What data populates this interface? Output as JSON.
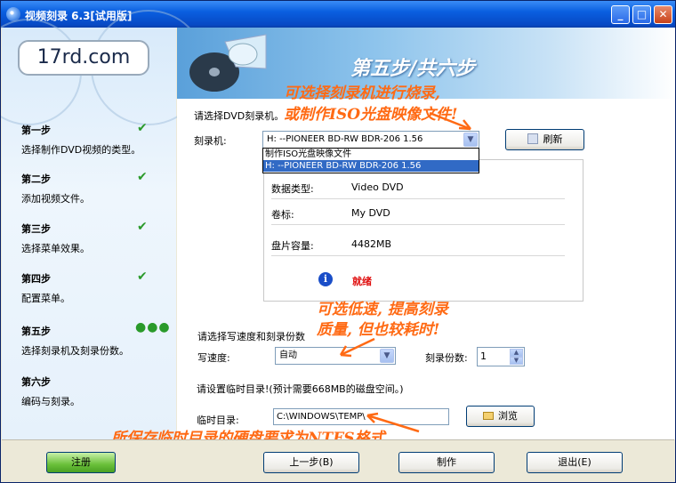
{
  "window": {
    "title": "视频刻录  6.3[试用版]",
    "minimize_glyph": "_",
    "maximize_glyph": "□",
    "close_glyph": "✕"
  },
  "logo": {
    "text": "17rd.com"
  },
  "banner": {
    "step_title": "第五步/共六步"
  },
  "steps": [
    {
      "title": "第一步",
      "desc": "选择制作DVD视频的类型。",
      "status": "done"
    },
    {
      "title": "第二步",
      "desc": "添加视频文件。",
      "status": "done"
    },
    {
      "title": "第三步",
      "desc": "选择菜单效果。",
      "status": "done"
    },
    {
      "title": "第四步",
      "desc": "配置菜单。",
      "status": "done"
    },
    {
      "title": "第五步",
      "desc": "选择刻录机及刻录份数。",
      "status": "current"
    },
    {
      "title": "第六步",
      "desc": "编码与刻录。",
      "status": "pending"
    }
  ],
  "icons": {
    "check": "✔",
    "dots": "●●●",
    "info": "i",
    "refresh": "refresh-icon",
    "browse": "folder-icon"
  },
  "burner": {
    "prompt": "请选择DVD刻录机。",
    "label": "刻录机:",
    "selected": "H:  --PIONEER BD-RW   BDR-206  1.56",
    "options": [
      "制作ISO光盘映像文件",
      "H:  --PIONEER BD-RW   BDR-206  1.56"
    ],
    "refresh_label": "刷新"
  },
  "info": {
    "data_type_label": "数据类型:",
    "data_type_value": "Video DVD",
    "volume_label": "卷标:",
    "volume_value": "My DVD",
    "capacity_label": "盘片容量:",
    "capacity_value": "4482MB",
    "status": "就绪"
  },
  "speed": {
    "prompt": "请选择写速度和刻录份数",
    "speed_label": "写速度:",
    "speed_value": "自动",
    "copies_label": "刻录份数:",
    "copies_value": "1"
  },
  "temp": {
    "prompt": "请设置临时目录!(预计需要668MB的磁盘空间。)",
    "label": "临时目录:",
    "value": "C:\\WINDOWS\\TEMP\\",
    "browse_label": "浏览"
  },
  "annotations": {
    "a1_line1": "可选择刻录机进行烧录,",
    "a1_line2": "或制作ISO光盘映像文件!",
    "a2_line1": "可选低速, 提高刻录",
    "a2_line2": "质量, 但也较耗时!",
    "a3": "所保存临时目录的硬盘要求为NTFS格式",
    "color": "#ff6a14"
  },
  "footer": {
    "register": "注册",
    "prev": "上一步(B)",
    "make": "制作",
    "exit": "退出(E)"
  }
}
